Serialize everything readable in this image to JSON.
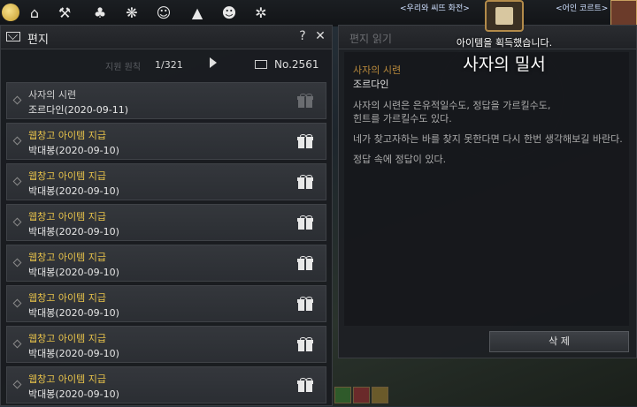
{
  "topbar": {
    "icons": [
      "gold-coin-icon",
      "home-icon",
      "pickaxe-icon",
      "farm-icon",
      "pet-icon",
      "mask-icon",
      "camp-icon",
      "family-icon",
      "butterfly-icon"
    ],
    "world_label_left": "<우리와 씨뜨 화전>",
    "world_label_right": "<어인 코르트>"
  },
  "mail": {
    "title": "편지",
    "help_label": "?",
    "close_label": "✕",
    "sort_label": "지원 원칙",
    "page_count": "1/321",
    "mail_number": "No.2561",
    "items": [
      {
        "subject": "사자의 시련",
        "sender": "조르다인(2020-09-11)",
        "read": true
      },
      {
        "subject": "웹창고 아이템 지급",
        "sender": "박대봉(2020-09-10)",
        "read": false
      },
      {
        "subject": "웹창고 아이템 지급",
        "sender": "박대봉(2020-09-10)",
        "read": false
      },
      {
        "subject": "웹창고 아이템 지급",
        "sender": "박대봉(2020-09-10)",
        "read": false
      },
      {
        "subject": "웹창고 아이템 지급",
        "sender": "박대봉(2020-09-10)",
        "read": false
      },
      {
        "subject": "웹창고 아이템 지급",
        "sender": "박대봉(2020-09-10)",
        "read": false
      },
      {
        "subject": "웹창고 아이템 지급",
        "sender": "박대봉(2020-09-10)",
        "read": false
      },
      {
        "subject": "웹창고 아이템 지급",
        "sender": "박대봉(2020-09-10)",
        "read": false
      }
    ]
  },
  "reader": {
    "title": "편지 읽기",
    "sender_label": "사자의 시련",
    "sender": "조르다인",
    "lines": [
      "사자의 시련은 은유적일수도, 정답을 가르킬수도,",
      "힌트를 가르킬수도 있다.",
      "네가 찾고자하는 바를 찾지 못한다면 다시 한번 생각해보길 바란다.",
      "정답 속에 정답이 있다."
    ],
    "delete_label": "삭 제"
  },
  "notification": {
    "small_text": "아이템을 획득했습니다.",
    "item_name": "사자의 밀서"
  }
}
